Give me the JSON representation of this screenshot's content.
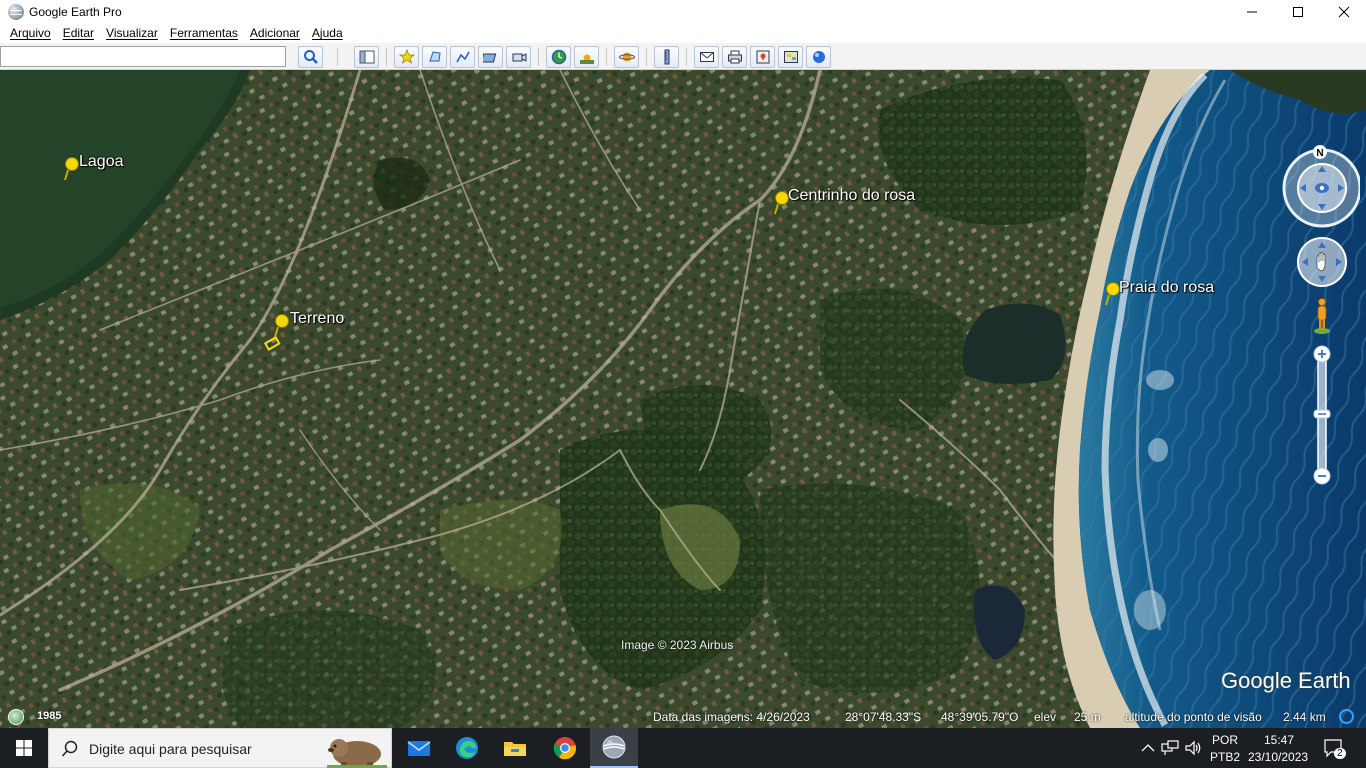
{
  "window": {
    "title": "Google Earth Pro",
    "icon": "google-earth-logo-icon",
    "controls": [
      "minimize-icon",
      "maximize-icon",
      "close-icon"
    ]
  },
  "menu": {
    "items": [
      {
        "label": "Arquivo"
      },
      {
        "label": "Editar"
      },
      {
        "label": "Visualizar"
      },
      {
        "label": "Ferramentas"
      },
      {
        "label": "Adicionar"
      },
      {
        "label": "Ajuda"
      }
    ]
  },
  "toolbar": {
    "search_value": "",
    "buttons": [
      "search-icon",
      "sidebar-toggle-icon",
      "add-placemark-icon",
      "add-polygon-icon",
      "add-path-icon",
      "add-image-overlay-icon",
      "record-tour-icon",
      "historical-imagery-icon",
      "sunlight-icon",
      "planets-icon",
      "ruler-icon",
      "email-icon",
      "print-icon",
      "save-image-icon",
      "view-in-maps-icon",
      "sign-in-icon"
    ]
  },
  "map": {
    "placemarks": [
      {
        "label": "Lagoa"
      },
      {
        "label": "Centrinho do rosa"
      },
      {
        "label": "Terreno"
      },
      {
        "label": "Praia do rosa"
      }
    ],
    "attribution": "Image © 2023 Airbus",
    "brand": "Google Earth",
    "compass_letter": "N"
  },
  "status": {
    "year": "1985",
    "imagery_date": "Data das imagens: 4/26/2023",
    "latitude": "28°07'48.33\"S",
    "longitude": "48°39'05.79\"O",
    "elevation_label": "elev",
    "elevation_value": "25 m",
    "eye_alt_label": "altitude do ponto de visão",
    "eye_alt_value": "2.44 km"
  },
  "taskbar": {
    "search_placeholder": "Digite aqui para pesquisar",
    "pinned": [
      "mail-icon",
      "edge-icon",
      "file-explorer-icon",
      "chrome-icon",
      "google-earth-icon"
    ],
    "language": "POR",
    "layout": "PTB2",
    "time": "15:47",
    "date": "23/10/2023",
    "notifications": "2"
  },
  "colors": {
    "taskbar_bg": "#1b1f24",
    "placemark_yellow": "#f5d800",
    "ocean": "#0f4a7a"
  }
}
